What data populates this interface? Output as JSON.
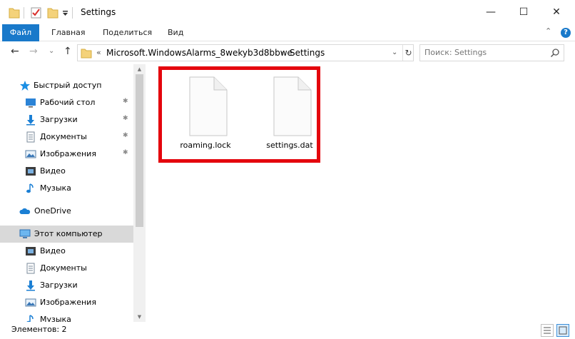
{
  "window": {
    "title": "Settings",
    "controls": {
      "minimize": "—",
      "maximize": "☐",
      "close": "✕"
    }
  },
  "ribbon": {
    "tabs": [
      "Файл",
      "Главная",
      "Поделиться",
      "Вид"
    ],
    "collapse_glyph": "⌃",
    "help_glyph": "?"
  },
  "nav": {
    "back": "←",
    "forward": "→",
    "recent": "⌄",
    "up": "↑",
    "path_prefix": "«",
    "path": [
      "Microsoft.WindowsAlarms_8wekyb3d8bbwe",
      "Settings"
    ],
    "path_separator": "›",
    "dropdown": "⌄",
    "refresh": "↻",
    "search_placeholder": "Поиск: Settings"
  },
  "sidebar": {
    "quick_access": "Быстрый доступ",
    "quick_items": [
      {
        "label": "Рабочий стол",
        "icon": "desktop-icon",
        "pinned": true
      },
      {
        "label": "Загрузки",
        "icon": "downloads-icon",
        "pinned": true
      },
      {
        "label": "Документы",
        "icon": "documents-icon",
        "pinned": true
      },
      {
        "label": "Изображения",
        "icon": "pictures-icon",
        "pinned": true
      },
      {
        "label": "Видео",
        "icon": "video-icon",
        "pinned": false
      },
      {
        "label": "Музыка",
        "icon": "music-icon",
        "pinned": false
      }
    ],
    "onedrive": "OneDrive",
    "this_pc": "Этот компьютер",
    "pc_items": [
      {
        "label": "Видео",
        "icon": "video-icon"
      },
      {
        "label": "Документы",
        "icon": "documents-icon"
      },
      {
        "label": "Загрузки",
        "icon": "downloads-icon"
      },
      {
        "label": "Изображения",
        "icon": "pictures-icon"
      },
      {
        "label": "Музыка",
        "icon": "music-icon"
      }
    ],
    "pin_glyph": "📌"
  },
  "files": [
    {
      "name": "roaming.lock",
      "icon": "file-icon"
    },
    {
      "name": "settings.dat",
      "icon": "file-icon"
    }
  ],
  "status": {
    "items_count": "Элементов: 2"
  },
  "colors": {
    "accent": "#1979ca",
    "highlight": "#e4050d",
    "selected": "#d9d9d9"
  }
}
